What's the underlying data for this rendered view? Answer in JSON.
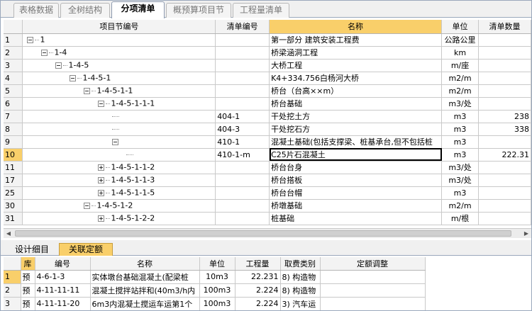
{
  "top_tabs": [
    "表格数据",
    "全树结构",
    "分项清单",
    "概预算项目节",
    "工程量清单"
  ],
  "active_top_tab": 2,
  "grid": {
    "headers": {
      "row": "",
      "code": "项目节编号",
      "list_code": "清单编号",
      "name": "名称",
      "unit": "单位",
      "qty": "清单数量"
    },
    "rows": [
      {
        "rn": "1",
        "toggle": "minus",
        "code": "1",
        "list_code": "",
        "name": "第一部分 建筑安装工程费",
        "unit": "公路公里",
        "qty": ""
      },
      {
        "rn": "2",
        "toggle": "minus",
        "code": "1-4",
        "list_code": "",
        "name": "桥梁涵洞工程",
        "unit": "km",
        "qty": ""
      },
      {
        "rn": "3",
        "toggle": "minus",
        "code": "1-4-5",
        "list_code": "",
        "name": "大桥工程",
        "unit": "m/座",
        "qty": ""
      },
      {
        "rn": "4",
        "toggle": "minus",
        "code": "1-4-5-1",
        "list_code": "",
        "name": "K4+334.756白杨河大桥",
        "unit": "m2/m",
        "qty": ""
      },
      {
        "rn": "5",
        "toggle": "minus",
        "code": "1-4-5-1-1",
        "list_code": "",
        "name": "桥台（台高××m）",
        "unit": "m2/m",
        "qty": ""
      },
      {
        "rn": "6",
        "toggle": "minus",
        "code": "1-4-5-1-1-1",
        "list_code": "",
        "name": "桥台基础",
        "unit": "m3/处",
        "qty": ""
      },
      {
        "rn": "7",
        "toggle": "none",
        "code": "",
        "list_code": "404-1",
        "name": "干处挖土方",
        "unit": "m3",
        "qty": "238"
      },
      {
        "rn": "8",
        "toggle": "none",
        "code": "",
        "list_code": "404-3",
        "name": "干处挖石方",
        "unit": "m3",
        "qty": "338"
      },
      {
        "rn": "9",
        "toggle": "minus",
        "code": "",
        "list_code": "410-1",
        "name": "混凝土基础(包括支撑梁、桩基承台,但不包括桩",
        "unit": "m3",
        "qty": ""
      },
      {
        "rn": "10",
        "toggle": "none",
        "code": "",
        "list_code": "410-1-m",
        "name": "C25片石混凝土",
        "unit": "m3",
        "qty": "222.31"
      },
      {
        "rn": "11",
        "toggle": "plus",
        "code": "1-4-5-1-1-2",
        "list_code": "",
        "name": "桥台台身",
        "unit": "m3/处",
        "qty": ""
      },
      {
        "rn": "17",
        "toggle": "plus",
        "code": "1-4-5-1-1-3",
        "list_code": "",
        "name": "桥台搭板",
        "unit": "m3/处",
        "qty": ""
      },
      {
        "rn": "25",
        "toggle": "plus",
        "code": "1-4-5-1-1-5",
        "list_code": "",
        "name": "桥台台帽",
        "unit": "m3",
        "qty": ""
      },
      {
        "rn": "30",
        "toggle": "minus",
        "code": "1-4-5-1-2",
        "list_code": "",
        "name": "桥墩基础",
        "unit": "m2/m",
        "qty": ""
      },
      {
        "rn": "31",
        "toggle": "plus",
        "code": "1-4-5-1-2-2",
        "list_code": "",
        "name": "桩基础",
        "unit": "m/根",
        "qty": ""
      }
    ],
    "selected_row": "10"
  },
  "bottom_tabs": [
    "设计细目",
    "关联定额"
  ],
  "active_bottom_tab": 1,
  "bottom_grid": {
    "headers": {
      "row": "",
      "ku": "库",
      "code": "编号",
      "name": "名称",
      "unit": "单位",
      "qty": "工程量",
      "fee": "取费类别",
      "adjust": "定额调整"
    },
    "rows": [
      {
        "rn": "1",
        "ku": "预",
        "code": "4-6-1-3",
        "name": "实体墩台基础混凝土(配梁桩",
        "unit": "10m3",
        "qty": "22.231",
        "fee": "8) 构造物",
        "adjust": ""
      },
      {
        "rn": "2",
        "ku": "预",
        "code": "4-11-11-11",
        "name": "混凝土搅拌站拌和(40m3/h内",
        "unit": "100m3",
        "qty": "2.224",
        "fee": "8) 构造物",
        "adjust": ""
      },
      {
        "rn": "3",
        "ku": "预",
        "code": "4-11-11-20",
        "name": "6m3内混凝土搅运车运第1个",
        "unit": "100m3",
        "qty": "2.224",
        "fee": "3) 汽车运",
        "adjust": ""
      }
    ]
  }
}
